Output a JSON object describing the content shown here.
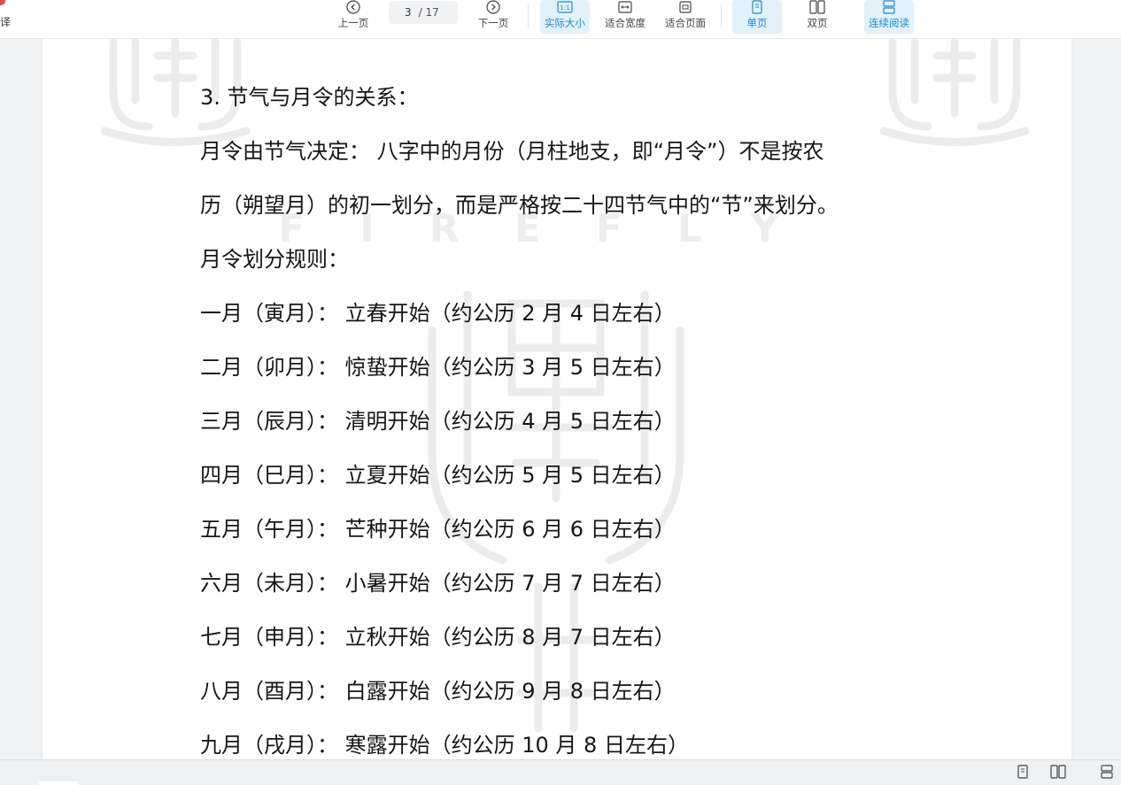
{
  "toolbar": {
    "left_label": "译",
    "prev_label": "上一页",
    "page_current": "3",
    "page_total": "/ 17",
    "next_label": "下一页",
    "actual_size_label": "实际大小",
    "fit_width_label": "适合宽度",
    "fit_page_label": "适合页面",
    "single_label": "单页",
    "double_label": "双页",
    "continuous_label": "连续阅读",
    "active_color": "#1a8ad4"
  },
  "document": {
    "heading": "3.   节气与月令的关系：",
    "para_line1": "月令由节气决定： 八字中的月份（月柱地支，即“月令”）不是按农",
    "para_line2": "历（朔望月）的初一划分，而是严格按二十四节气中的“节”来划分。",
    "rules_title": "月令划分规则：",
    "months": [
      "一月（寅月）： 立春开始（约公历 2 月 4 日左右）",
      "二月（卯月）： 惊蛰开始（约公历 3 月 5 日左右）",
      "三月（辰月）： 清明开始（约公历 4 月 5 日左右）",
      "四月（巳月）： 立夏开始（约公历 5 月 5 日左右）",
      "五月（午月）： 芒种开始（约公历 6 月 6 日左右）",
      "六月（未月）： 小暑开始（约公历 7 月 7 日左右）",
      "七月（申月）： 立秋开始（约公历 8 月 7 日左右）",
      "八月（酉月）： 白露开始（约公历 9 月 8 日左右）",
      "九月（戌月）： 寒露开始（约公历 10 月 8 日左右）"
    ],
    "watermark_text": "FIREFLY"
  },
  "statusbar": {
    "icons": [
      "single-page-icon",
      "double-page-icon",
      "continuous-icon"
    ]
  }
}
